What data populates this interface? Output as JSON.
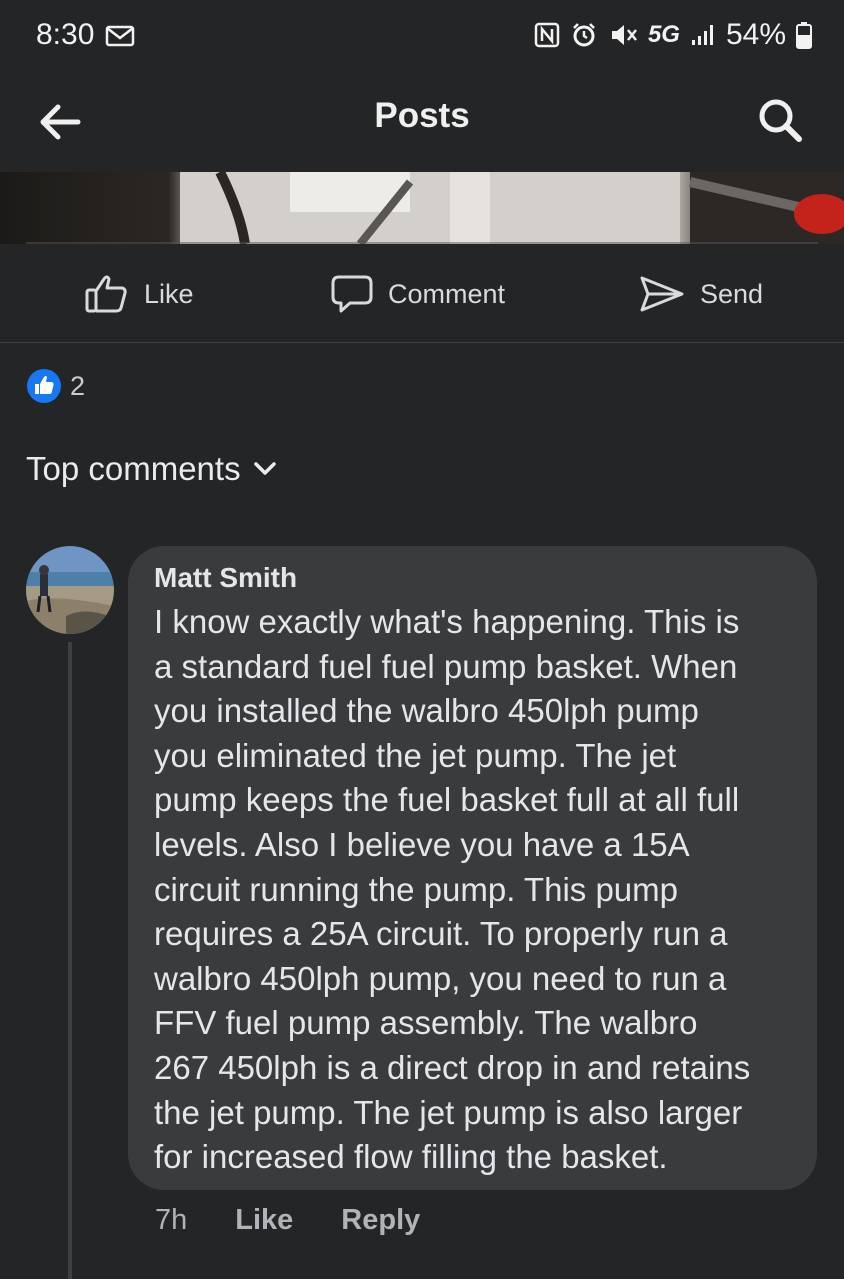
{
  "status_bar": {
    "time": "8:30",
    "network": "5G",
    "battery": "54%"
  },
  "header": {
    "title": "Posts"
  },
  "actions": {
    "like": "Like",
    "comment": "Comment",
    "send": "Send"
  },
  "reactions": {
    "count": "2"
  },
  "comments_section": {
    "filter_label": "Top comments"
  },
  "comment": {
    "author": "Matt Smith",
    "text": "I know exactly what's happening. This is\na standard fuel fuel pump basket. When\nyou installed the walbro 450lph pump\nyou eliminated the jet pump. The jet\npump keeps the fuel basket full at all full\nlevels. Also I believe you have a 15A\ncircuit running the pump. This pump\nrequires a 25A circuit. To properly run a\nwalbro 450lph pump, you need to run a\nFFV fuel pump assembly. The walbro\n267 450lph is a direct drop in and retains\nthe jet pump. The jet pump is also larger\nfor increased flow filling the basket.",
    "time": "7h",
    "like_label": "Like",
    "reply_label": "Reply"
  },
  "colors": {
    "background": "#242526",
    "bubble": "#3a3b3c",
    "like_blue": "#1877f2"
  }
}
